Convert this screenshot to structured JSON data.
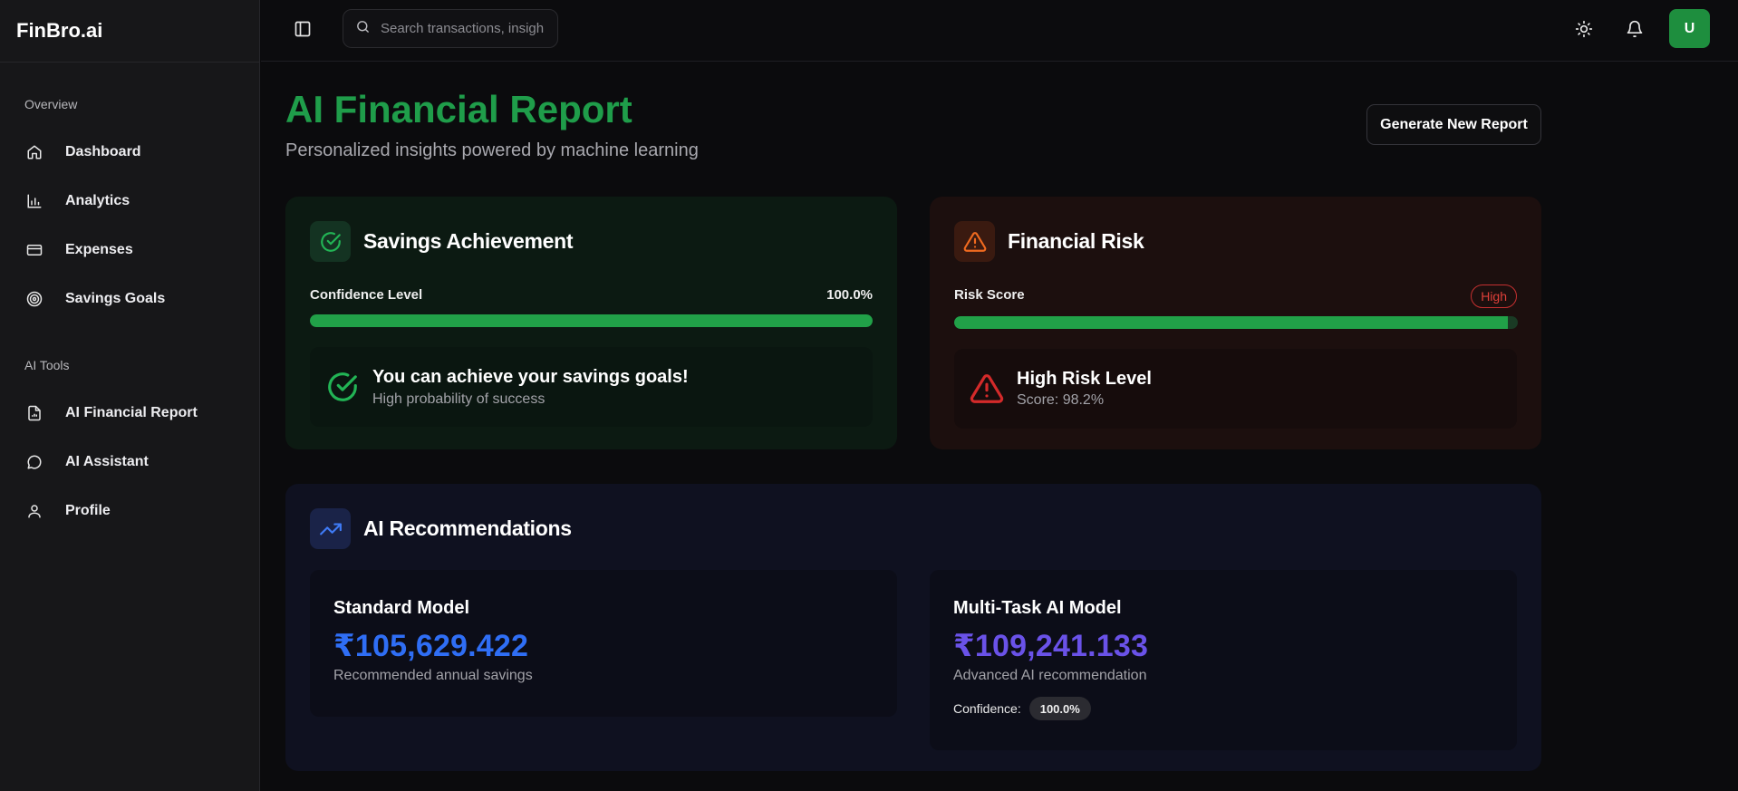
{
  "brand": "FinBro.ai",
  "sidebar": {
    "sections": [
      {
        "label": "Overview",
        "items": [
          {
            "label": "Dashboard",
            "icon": "home-icon"
          },
          {
            "label": "Analytics",
            "icon": "bar-chart-icon"
          },
          {
            "label": "Expenses",
            "icon": "credit-card-icon"
          },
          {
            "label": "Savings Goals",
            "icon": "target-icon"
          }
        ]
      },
      {
        "label": "AI Tools",
        "items": [
          {
            "label": "AI Financial Report",
            "icon": "file-report-icon"
          },
          {
            "label": "AI Assistant",
            "icon": "chat-bubble-icon"
          },
          {
            "label": "Profile",
            "icon": "user-icon"
          }
        ]
      }
    ]
  },
  "topbar": {
    "search_placeholder": "Search transactions, insights...",
    "avatar_initial": "U"
  },
  "page": {
    "title": "AI Financial Report",
    "subtitle": "Personalized insights powered by machine learning",
    "generate_button": "Generate New Report"
  },
  "savings": {
    "title": "Savings Achievement",
    "meter_label": "Confidence Level",
    "meter_value": "100.0%",
    "meter_fraction": 1.0,
    "message_title": "You can achieve your savings goals!",
    "message_sub": "High probability of success"
  },
  "risk": {
    "title": "Financial Risk",
    "meter_label": "Risk Score",
    "badge": "High",
    "meter_fraction": 0.982,
    "message_title": "High Risk Level",
    "message_sub": "Score: 98.2%"
  },
  "recommendations": {
    "title": "AI Recommendations",
    "standard": {
      "name": "Standard Model",
      "value": "₹105,629.422",
      "desc": "Recommended annual savings"
    },
    "multitask": {
      "name": "Multi-Task AI Model",
      "value": "₹109,241.133",
      "desc": "Advanced AI recommendation",
      "confidence_label": "Confidence:",
      "confidence_value": "100.0%"
    }
  },
  "colors": {
    "accent_green": "#1f9d4a",
    "risk_red": "#e0403a",
    "standard_blue": "#2f6ef5",
    "multitask_purple": "#6a52e8"
  }
}
